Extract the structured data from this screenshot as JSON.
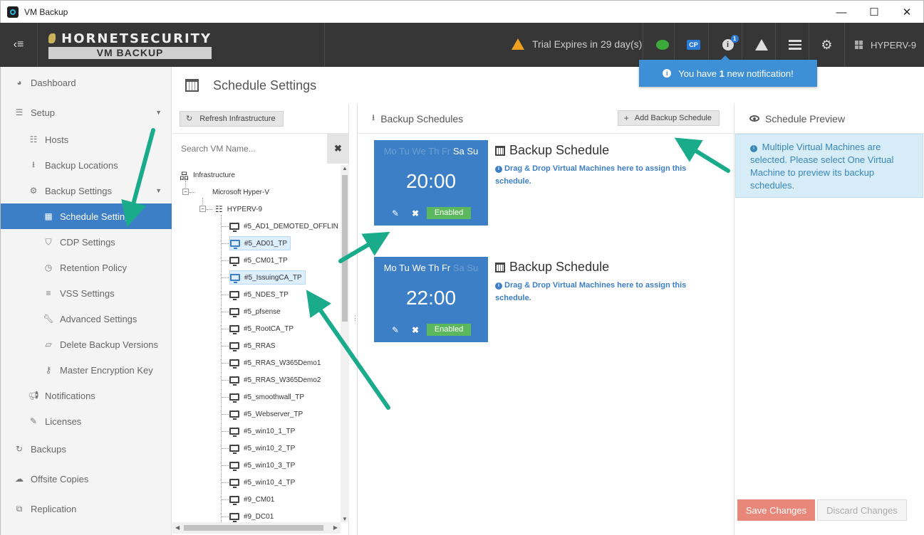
{
  "window": {
    "title": "VM Backup",
    "minimize": "—",
    "maximize": "☐",
    "close": "✕"
  },
  "header": {
    "brand": "HORNETSECURITY",
    "product": "VM BACKUP",
    "trial_text": "Trial Expires in 29 day(s)",
    "cp_label": "CP",
    "info_badge": "1",
    "host": "HYPERV-9",
    "icons": [
      "menu-icon",
      "warning-icon",
      "chat-icon",
      "cp-icon",
      "info-icon",
      "alert-icon",
      "list-icon",
      "settings-icon",
      "windows-icon"
    ]
  },
  "notification": {
    "prefix": "You have",
    "count": "1",
    "suffix": "new notification!"
  },
  "sidebar": {
    "items": [
      {
        "label": "Dashboard",
        "icon": "dashboard-icon"
      },
      {
        "label": "Setup",
        "icon": "sliders-icon"
      },
      {
        "label": "Hosts",
        "icon": "list-icon"
      },
      {
        "label": "Backup Locations",
        "icon": "download-icon"
      },
      {
        "label": "Backup Settings",
        "icon": "gears-icon"
      },
      {
        "label": "Schedule Settings",
        "icon": "calendar-icon"
      },
      {
        "label": "CDP Settings",
        "icon": "shield-icon"
      },
      {
        "label": "Retention Policy",
        "icon": "clock-icon"
      },
      {
        "label": "VSS Settings",
        "icon": "bars-icon"
      },
      {
        "label": "Advanced Settings",
        "icon": "wrench-icon"
      },
      {
        "label": "Delete Backup Versions",
        "icon": "eraser-icon"
      },
      {
        "label": "Master Encryption Key",
        "icon": "key-icon"
      },
      {
        "label": "Notifications",
        "icon": "bullhorn-icon"
      },
      {
        "label": "Licenses",
        "icon": "edit-icon"
      },
      {
        "label": "Backups",
        "icon": "refresh-icon"
      },
      {
        "label": "Offsite Copies",
        "icon": "cloud-upload-icon"
      },
      {
        "label": "Replication",
        "icon": "copy-icon"
      }
    ]
  },
  "page": {
    "title": "Schedule Settings"
  },
  "infrastructure": {
    "refresh_label": "Refresh Infrastructure",
    "search_placeholder": "Search VM Name...",
    "root": "Infrastructure",
    "hypervisor": "Microsoft Hyper-V",
    "host": "HYPERV-9",
    "vms": [
      {
        "name": "#5_AD1_DEMOTED_OFFLIN",
        "selected": false
      },
      {
        "name": "#5_AD01_TP",
        "selected": true
      },
      {
        "name": "#5_CM01_TP",
        "selected": false
      },
      {
        "name": "#5_IssuingCA_TP",
        "selected": true
      },
      {
        "name": "#5_NDES_TP",
        "selected": false
      },
      {
        "name": "#5_pfsense",
        "selected": false
      },
      {
        "name": "#5_RootCA_TP",
        "selected": false
      },
      {
        "name": "#5_RRAS",
        "selected": false
      },
      {
        "name": "#5_RRAS_W365Demo1",
        "selected": false
      },
      {
        "name": "#5_RRAS_W365Demo2",
        "selected": false
      },
      {
        "name": "#5_smoothwall_TP",
        "selected": false
      },
      {
        "name": "#5_Webserver_TP",
        "selected": false
      },
      {
        "name": "#5_win10_1_TP",
        "selected": false
      },
      {
        "name": "#5_win10_2_TP",
        "selected": false
      },
      {
        "name": "#5_win10_3_TP",
        "selected": false
      },
      {
        "name": "#5_win10_4_TP",
        "selected": false
      },
      {
        "name": "#9_CM01",
        "selected": false
      },
      {
        "name": "#9_DC01",
        "selected": false
      }
    ]
  },
  "schedules": {
    "panel_title": "Backup Schedules",
    "add_label": "Add Backup Schedule",
    "items": [
      {
        "days": [
          {
            "d": "Mo",
            "on": false
          },
          {
            "d": "Tu",
            "on": false
          },
          {
            "d": "We",
            "on": false
          },
          {
            "d": "Th",
            "on": false
          },
          {
            "d": "Fr",
            "on": false
          },
          {
            "d": "Sa",
            "on": true
          },
          {
            "d": "Su",
            "on": true
          }
        ],
        "time": "20:00",
        "status": "Enabled",
        "title": "Backup Schedule",
        "description": "Drag & Drop Virtual Machines here to assign this schedule."
      },
      {
        "days": [
          {
            "d": "Mo",
            "on": true
          },
          {
            "d": "Tu",
            "on": true
          },
          {
            "d": "We",
            "on": true
          },
          {
            "d": "Th",
            "on": true
          },
          {
            "d": "Fr",
            "on": true
          },
          {
            "d": "Sa",
            "on": false
          },
          {
            "d": "Su",
            "on": false
          }
        ],
        "time": "22:00",
        "status": "Enabled",
        "title": "Backup Schedule",
        "description": "Drag & Drop Virtual Machines here to assign this schedule."
      }
    ]
  },
  "preview": {
    "title": "Schedule Preview",
    "message": "Multiple Virtual Machines are selected. Please select One Virtual Machine to preview its backup schedules."
  },
  "footer": {
    "save_label": "Save Changes",
    "discard_label": "Discard Changes"
  },
  "colors": {
    "accent": "#3d7fc6",
    "enabled": "#5cb85c",
    "save": "#e8877a",
    "header": "#363636",
    "annotation": "#1aab8a"
  }
}
